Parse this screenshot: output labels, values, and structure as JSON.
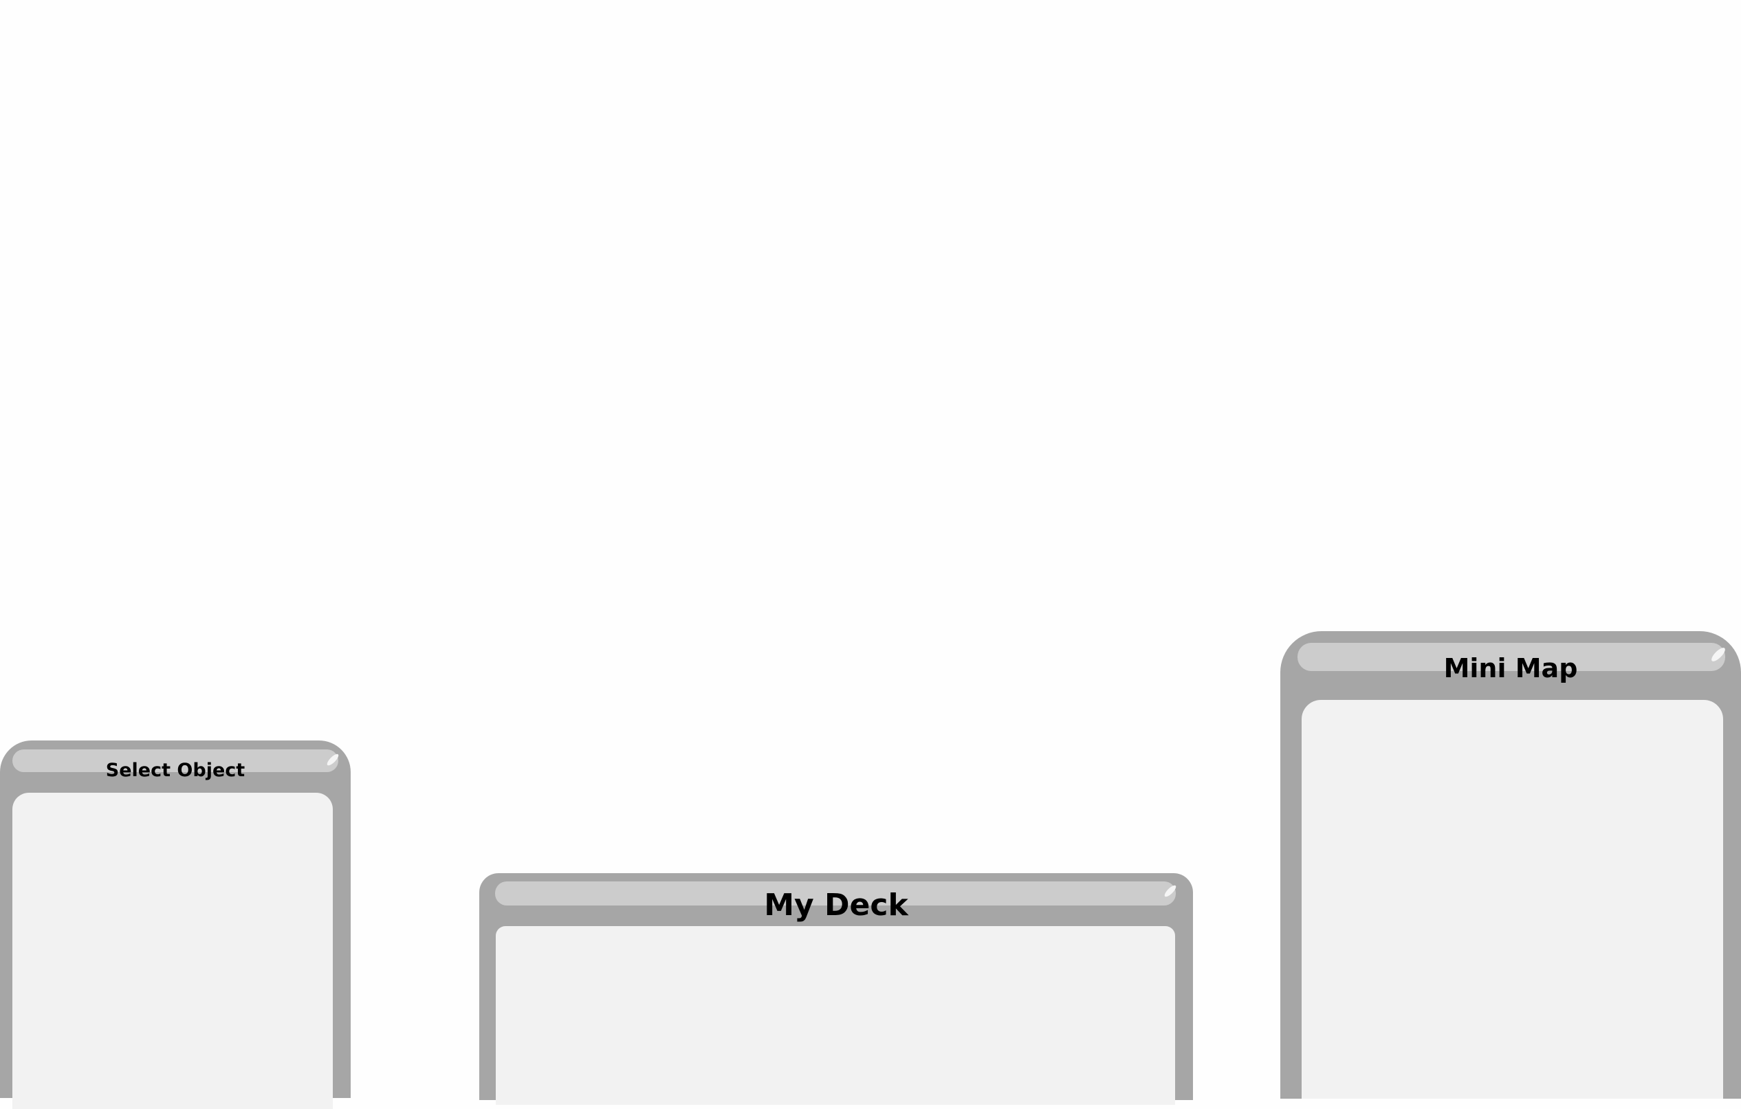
{
  "panels": {
    "select_object": {
      "title": "Select Object"
    },
    "my_deck": {
      "title": "My Deck"
    },
    "mini_map": {
      "title": "Mini Map"
    }
  },
  "colors": {
    "background": "#fefefe",
    "panel_frame": "#a6a6a6",
    "title_bar": "#cccccc",
    "content_area": "#f2f2f2",
    "title_text": "#000000"
  }
}
